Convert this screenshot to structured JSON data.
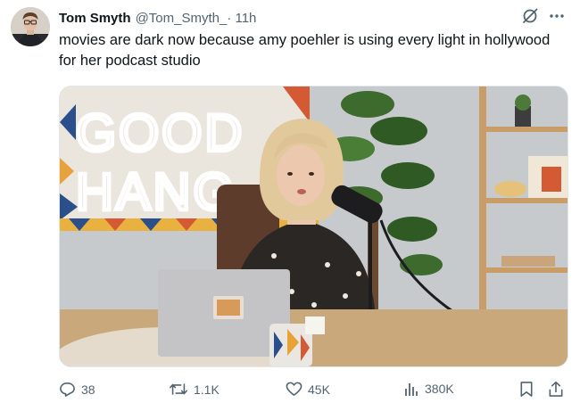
{
  "tweet": {
    "author_name": "Tom Smyth",
    "handle": "@Tom_Smyth_",
    "time": " · 11h",
    "text": "movies are dark now because amy poehler is using every light in hollywood for her podcast studio"
  },
  "media": {
    "neon_sign_line1": "GOOD",
    "neon_sign_line2": "HANG"
  },
  "actions": {
    "replies": "38",
    "reposts": "1.1K",
    "likes": "45K",
    "views": "380K"
  },
  "colors": {
    "text": "#0f1419",
    "secondary": "#536471",
    "background": "#ffffff"
  },
  "icons": [
    "grok-icon",
    "more-icon",
    "reply-icon",
    "repost-icon",
    "like-icon",
    "views-icon",
    "bookmark-icon",
    "share-icon"
  ]
}
